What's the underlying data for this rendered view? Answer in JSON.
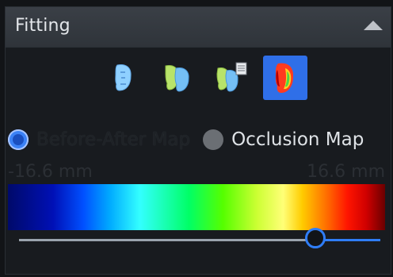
{
  "panel": {
    "title": "Fitting",
    "collapse_icon": "triangle-up-icon"
  },
  "toolbar": {
    "buttons": [
      {
        "icon": "face-single-icon",
        "active": false
      },
      {
        "icon": "face-overlay-icon",
        "active": false
      },
      {
        "icon": "face-compare-report-icon",
        "active": false
      },
      {
        "icon": "heatmap-face-icon",
        "active": true
      }
    ]
  },
  "map_mode": {
    "options": [
      {
        "label": "Before-After Map",
        "selected": true
      },
      {
        "label": "Occlusion Map",
        "selected": false
      }
    ]
  },
  "range": {
    "min_label": "-16.6 mm",
    "max_label": "16.6 mm"
  },
  "slider": {
    "value_fraction": 0.82
  },
  "colors": {
    "accent": "#2f7df6",
    "header_bg": "#353a40",
    "panel_bg": "#181b1f"
  }
}
